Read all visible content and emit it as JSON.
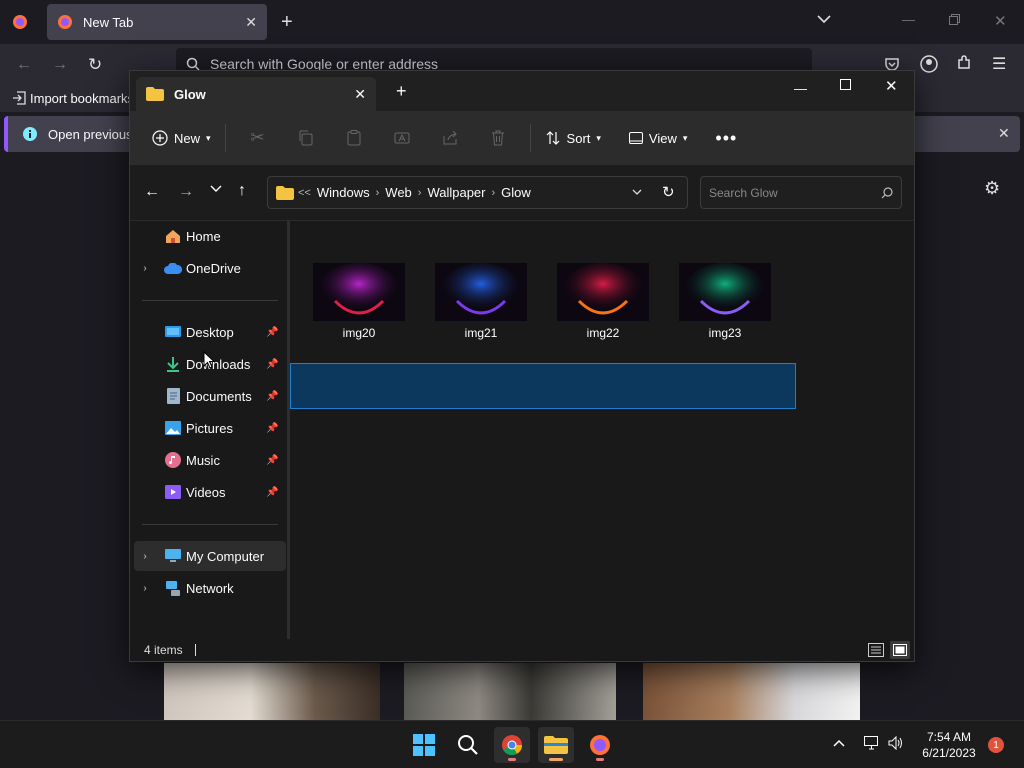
{
  "firefox": {
    "tab_title": "New Tab",
    "url_placeholder": "Search with Google or enter address",
    "bookmark_import": "Import bookmarks",
    "notice_text": "Open previous ta"
  },
  "explorer": {
    "tab_title": "Glow",
    "toolbar": {
      "new_label": "New",
      "sort_label": "Sort",
      "view_label": "View"
    },
    "breadcrumb": {
      "overflow": "<<",
      "items": [
        "Windows",
        "Web",
        "Wallpaper",
        "Glow"
      ]
    },
    "search_placeholder": "Search Glow",
    "nav": {
      "home": "Home",
      "onedrive": "OneDrive",
      "desktop": "Desktop",
      "downloads": "Downloads",
      "documents": "Documents",
      "pictures": "Pictures",
      "music": "Music",
      "videos": "Videos",
      "mycomputer": "My Computer",
      "network": "Network"
    },
    "files": [
      {
        "name": "img20",
        "glow": "#c026d3",
        "rim": "#e11d48"
      },
      {
        "name": "img21",
        "glow": "#2563eb",
        "rim": "#7c3aed"
      },
      {
        "name": "img22",
        "glow": "#e11d48",
        "rim": "#f97316"
      },
      {
        "name": "img23",
        "glow": "#10b981",
        "rim": "#8b5cf6"
      }
    ],
    "status_text": "4 items"
  },
  "taskbar": {
    "time": "7:54 AM",
    "date": "6/21/2023",
    "notification_count": "1"
  }
}
